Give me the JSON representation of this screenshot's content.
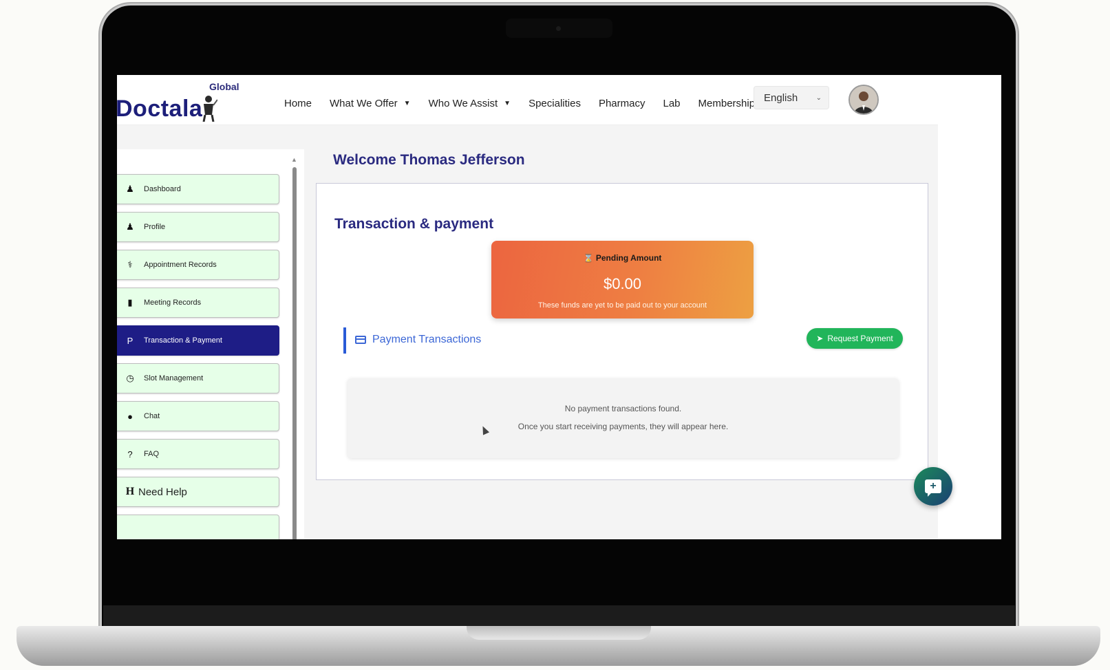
{
  "brand": {
    "name": "Doctala",
    "superscript": "Global"
  },
  "nav": {
    "items": [
      {
        "label": "Home",
        "dropdown": false
      },
      {
        "label": "What We Offer",
        "dropdown": true
      },
      {
        "label": "Who We Assist",
        "dropdown": true
      },
      {
        "label": "Specialities",
        "dropdown": false
      },
      {
        "label": "Pharmacy",
        "dropdown": false
      },
      {
        "label": "Lab",
        "dropdown": false
      },
      {
        "label": "Membership",
        "dropdown": false
      }
    ],
    "language": "English"
  },
  "sidebar": {
    "items": [
      {
        "label": "Dashboard",
        "icon": "user-doctor-icon",
        "glyph": "♟"
      },
      {
        "label": "Profile",
        "icon": "user-doctor-icon",
        "glyph": "♟"
      },
      {
        "label": "Appointment Records",
        "icon": "stethoscope-icon",
        "glyph": "⚕"
      },
      {
        "label": "Meeting Records",
        "icon": "file-icon",
        "glyph": "▮"
      },
      {
        "label": "Transaction & Payment",
        "icon": "paypal-icon",
        "glyph": "P",
        "active": true
      },
      {
        "label": "Slot Management",
        "icon": "clock-icon",
        "glyph": "◷"
      },
      {
        "label": "Chat",
        "icon": "comments-icon",
        "glyph": "●"
      },
      {
        "label": "FAQ",
        "icon": "question-circle-icon",
        "glyph": "?"
      },
      {
        "label": "Need Help",
        "icon": "h-icon",
        "glyph": "H"
      }
    ]
  },
  "main": {
    "welcome": "Welcome Thomas Jefferson",
    "section_title": "Transaction & payment",
    "pending": {
      "label": "Pending Amount",
      "icon": "hourglass-icon",
      "amount": "$0.00",
      "note": "These funds are yet to be paid out to your account"
    },
    "payment_transactions": {
      "heading": "Payment Transactions",
      "request_button": "Request Payment",
      "empty_line1": "No payment transactions found.",
      "empty_line2": "Once you start receiving payments, they will appear here."
    }
  },
  "colors": {
    "brand_navy": "#1e1d86",
    "sidebar_item_bg": "#e6ffe8",
    "request_green": "#21b55a",
    "heading_blue": "#3c67d6",
    "pending_gradient_start": "#ec6540",
    "pending_gradient_end": "#eda042"
  }
}
